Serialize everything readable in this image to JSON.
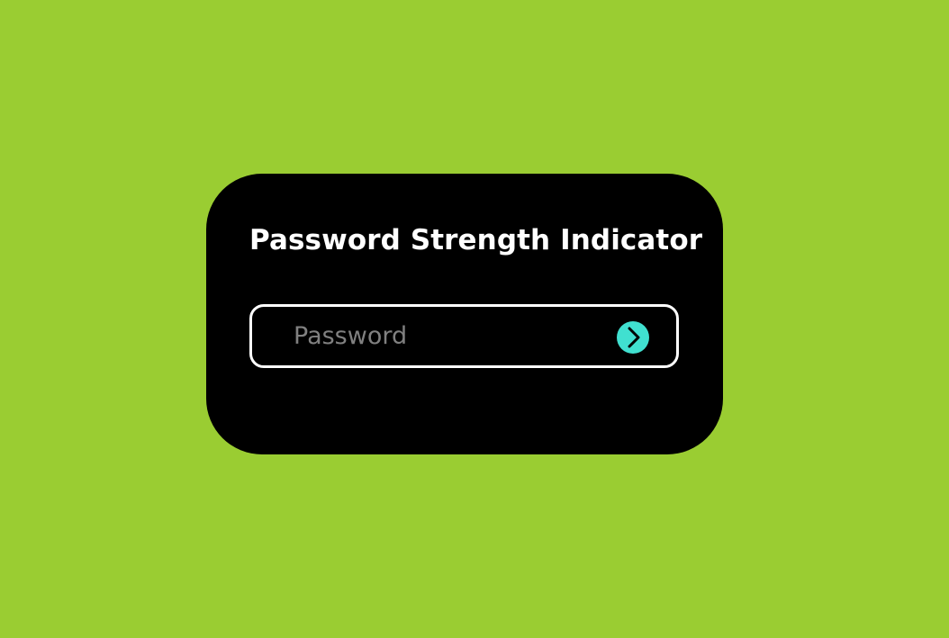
{
  "page": {
    "background_color": "#9acd32"
  },
  "card": {
    "title": "Password Strength Indicator",
    "background_color": "#000000"
  },
  "password_field": {
    "value": "",
    "placeholder": "Password",
    "border_color": "#ffffff"
  },
  "submit_button": {
    "icon": "chevron-right-icon",
    "color": "#40e0d0"
  }
}
